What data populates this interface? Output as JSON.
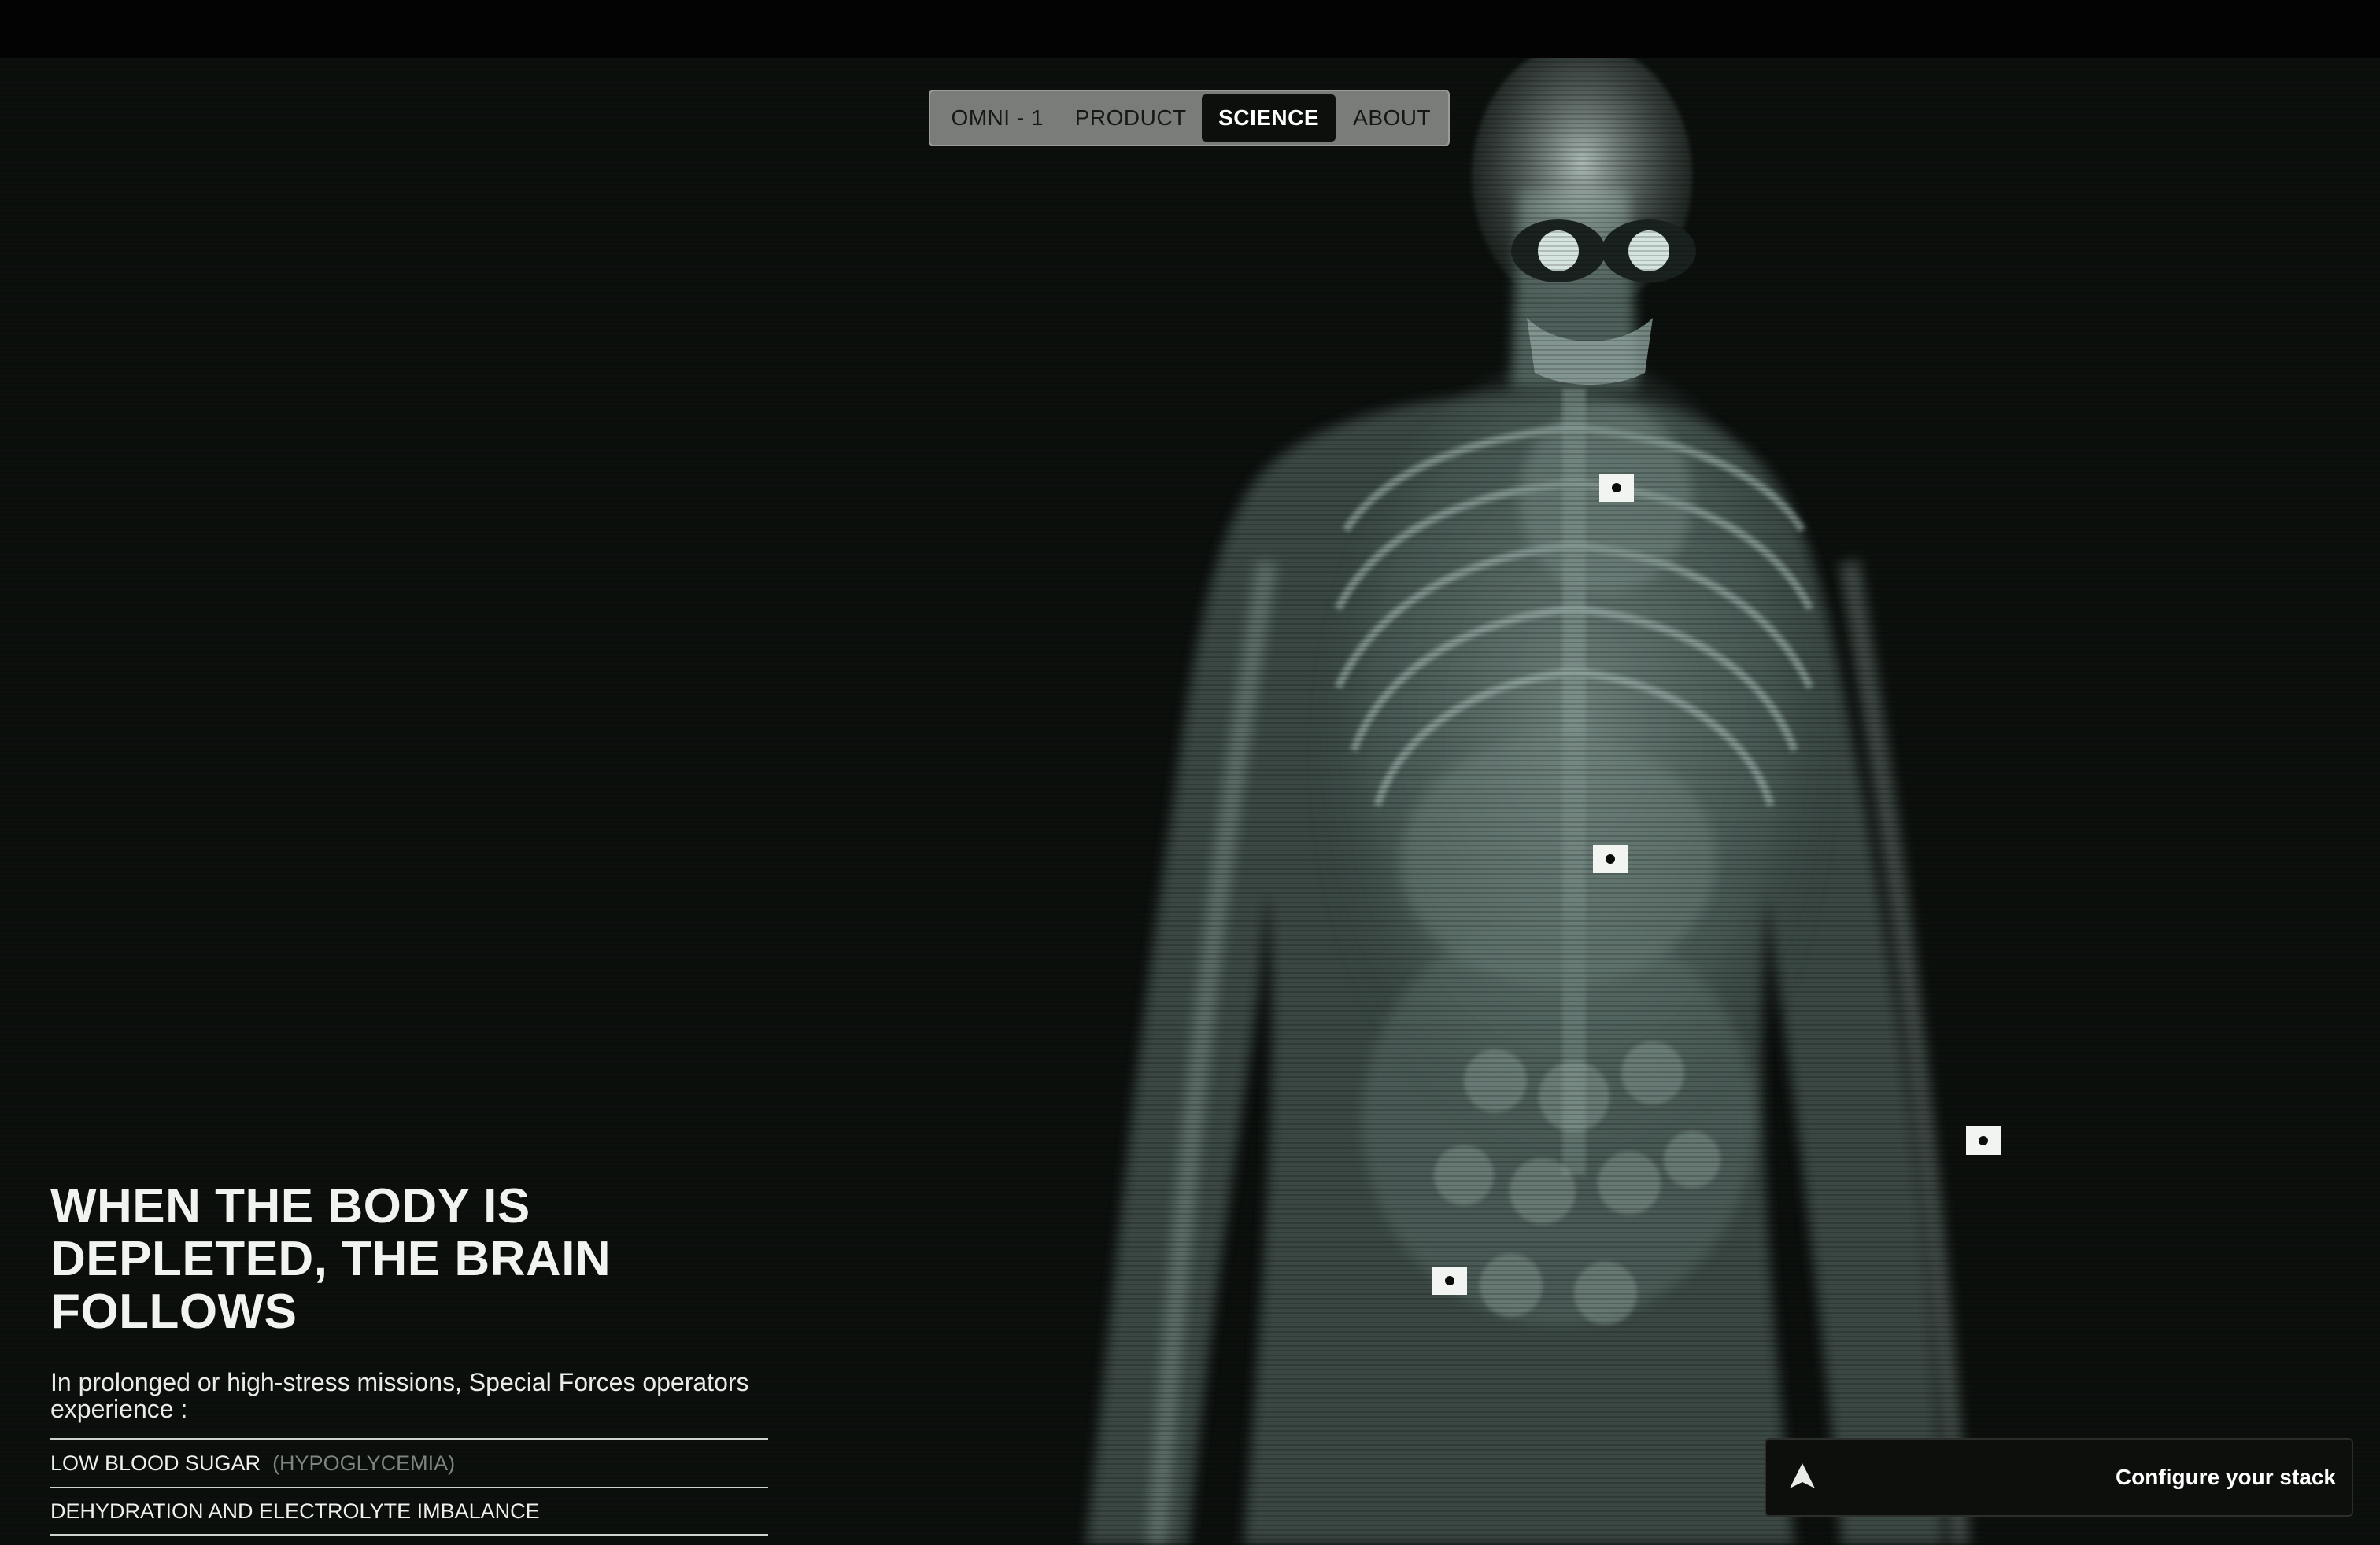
{
  "nav": {
    "items": [
      "OMNI - 1",
      "PRODUCT",
      "SCIENCE",
      "ABOUT"
    ],
    "active": "SCIENCE"
  },
  "hero": {
    "headline_lines": [
      "WHEN THE BODY IS",
      "DEPLETED, THE BRAIN",
      "FOLLOWS"
    ],
    "intro": "In prolonged or high-stress missions, Special Forces operators experience :"
  },
  "conditions": [
    {
      "label": "LOW BLOOD SUGAR",
      "detail": "(HYPOGLYCEMIA)"
    },
    {
      "label": "DEHYDRATION AND ELECTROLYTE IMBALANCE",
      "detail": ""
    }
  ],
  "cta": {
    "label": "Configure your stack",
    "icon": "arrow-up-icon"
  },
  "hotspots": [
    {
      "name": "hotspot-neck"
    },
    {
      "name": "hotspot-heart"
    },
    {
      "name": "hotspot-arm"
    },
    {
      "name": "hotspot-abdomen"
    }
  ],
  "colors": {
    "background": "#0c100d",
    "accent": "#f2f4f2",
    "nav_active": "#0d0f0d",
    "nav_bg": "#7a7c7a"
  }
}
